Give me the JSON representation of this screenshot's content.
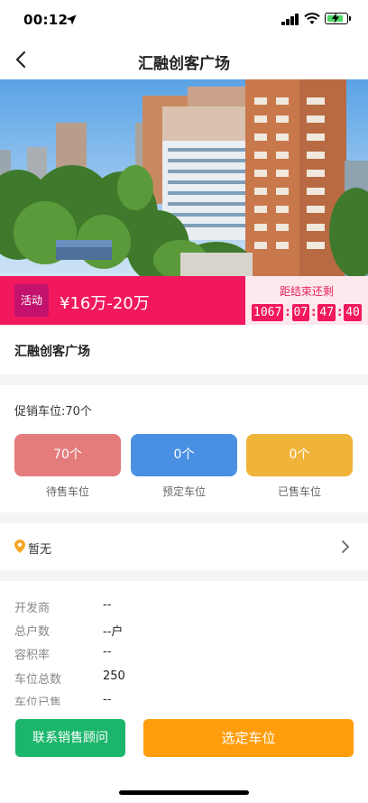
{
  "status_bar": {
    "time": "00:12"
  },
  "nav": {
    "title": "汇融创客广场"
  },
  "promo": {
    "badge": "活动",
    "price": "¥16万-20万",
    "countdown_label": "距结束还剩",
    "countdown": [
      "1067",
      "07",
      "47",
      "40"
    ]
  },
  "project": {
    "name": "汇融创客广场"
  },
  "parking": {
    "promo_count": "促销车位:70个",
    "stats": [
      {
        "value": "70个",
        "label": "待售车位",
        "color": "#e57c7c"
      },
      {
        "value": "0个",
        "label": "预定车位",
        "color": "#4a90e2"
      },
      {
        "value": "0个",
        "label": "已售车位",
        "color": "#f0b43a"
      }
    ]
  },
  "address": {
    "text": "暂无"
  },
  "info": [
    {
      "label": "开发商",
      "value": "--"
    },
    {
      "label": "总户数",
      "value": "--户"
    },
    {
      "label": "容积率",
      "value": "--"
    },
    {
      "label": "车位总数",
      "value": "250"
    },
    {
      "label": "车位已售",
      "value": "--"
    }
  ],
  "actions": {
    "contact": "联系销售顾问",
    "select": "选定车位"
  },
  "colors": {
    "accent_pink": "#f2185e",
    "green": "#1bb66c",
    "orange": "#ff9d0c"
  }
}
